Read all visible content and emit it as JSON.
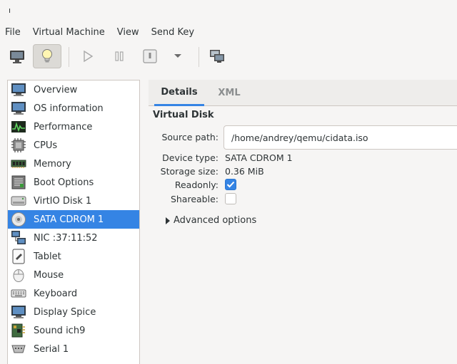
{
  "window": {
    "title": "ı"
  },
  "menubar": {
    "items": [
      "File",
      "Virtual Machine",
      "View",
      "Send Key"
    ]
  },
  "toolbar": {
    "buttons": [
      {
        "name": "console",
        "icon": "monitor-icon"
      },
      {
        "name": "details",
        "icon": "lightbulb-icon",
        "active": true
      },
      {
        "name": "run",
        "icon": "play-icon"
      },
      {
        "name": "pause",
        "icon": "pause-icon"
      },
      {
        "name": "shutdown",
        "icon": "power-icon"
      },
      {
        "name": "shutdown-menu",
        "icon": "chevron-down-icon"
      },
      {
        "name": "snapshots",
        "icon": "snapshots-icon"
      }
    ]
  },
  "sidebar": {
    "items": [
      {
        "label": "Overview",
        "icon": "monitor-icon"
      },
      {
        "label": "OS information",
        "icon": "monitor-icon"
      },
      {
        "label": "Performance",
        "icon": "performance-icon"
      },
      {
        "label": "CPUs",
        "icon": "cpu-icon"
      },
      {
        "label": "Memory",
        "icon": "memory-icon"
      },
      {
        "label": "Boot Options",
        "icon": "boot-icon"
      },
      {
        "label": "VirtIO Disk 1",
        "icon": "disk-icon"
      },
      {
        "label": "SATA CDROM 1",
        "icon": "cdrom-icon",
        "selected": true
      },
      {
        "label": "NIC :37:11:52",
        "icon": "network-icon"
      },
      {
        "label": "Tablet",
        "icon": "tablet-icon"
      },
      {
        "label": "Mouse",
        "icon": "mouse-icon"
      },
      {
        "label": "Keyboard",
        "icon": "keyboard-icon"
      },
      {
        "label": "Display Spice",
        "icon": "display-icon"
      },
      {
        "label": "Sound ich9",
        "icon": "sound-icon"
      },
      {
        "label": "Serial 1",
        "icon": "serial-icon"
      }
    ]
  },
  "tabs": [
    {
      "label": "Details",
      "active": true
    },
    {
      "label": "XML",
      "active": false
    }
  ],
  "details": {
    "section_title": "Virtual Disk",
    "source_path_label": "Source path:",
    "source_path_value": "/home/andrey/qemu/cidata.iso",
    "device_type_label": "Device type:",
    "device_type_value": "SATA CDROM 1",
    "storage_size_label": "Storage size:",
    "storage_size_value": "0.36 MiB",
    "readonly_label": "Readonly:",
    "readonly_checked": true,
    "shareable_label": "Shareable:",
    "shareable_checked": false,
    "advanced_label": "Advanced options"
  },
  "colors": {
    "accent": "#3584e4",
    "sidebar_bg": "#ffffff",
    "window_bg": "#f6f5f4"
  }
}
